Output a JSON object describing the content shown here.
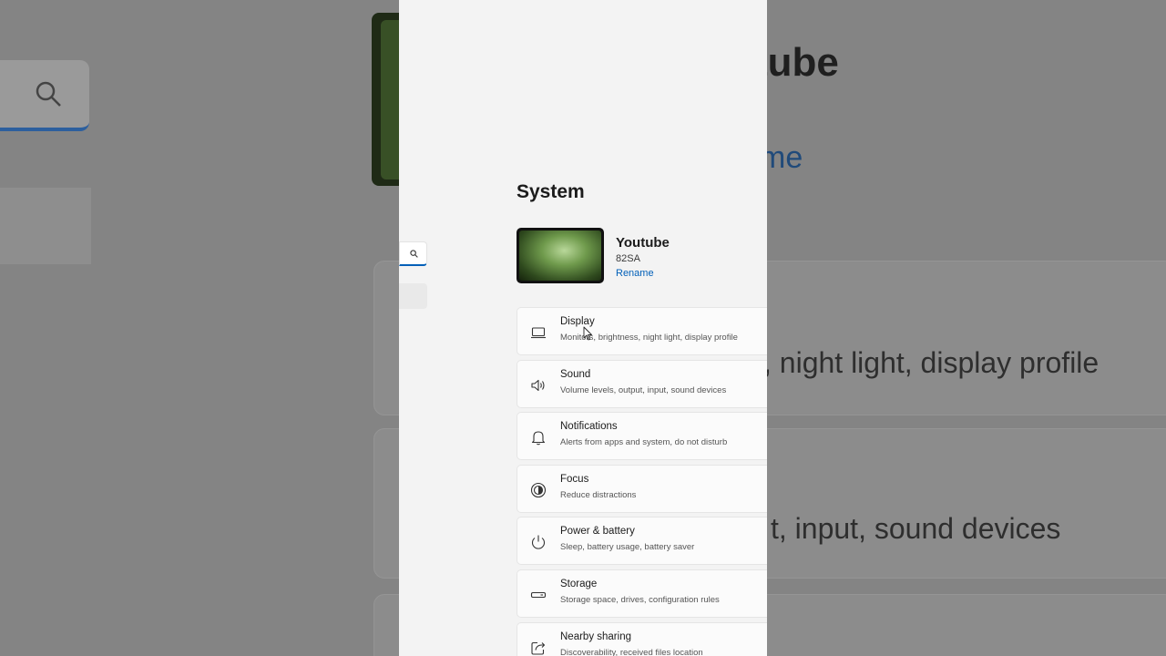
{
  "page": {
    "title": "System"
  },
  "device": {
    "name": "Youtube",
    "model": "82SA",
    "rename_label": "Rename"
  },
  "settings_items": [
    {
      "icon": "laptop-icon",
      "title": "Display",
      "subtitle": "Monitors, brightness, night light, display profile"
    },
    {
      "icon": "speaker-icon",
      "title": "Sound",
      "subtitle": "Volume levels, output, input, sound devices"
    },
    {
      "icon": "bell-icon",
      "title": "Notifications",
      "subtitle": "Alerts from apps and system, do not disturb"
    },
    {
      "icon": "focus-icon",
      "title": "Focus",
      "subtitle": "Reduce distractions"
    },
    {
      "icon": "power-icon",
      "title": "Power & battery",
      "subtitle": "Sleep, battery usage, battery saver"
    },
    {
      "icon": "storage-icon",
      "title": "Storage",
      "subtitle": "Storage space, drives, configuration rules"
    },
    {
      "icon": "share-icon",
      "title": "Nearby sharing",
      "subtitle": "Discoverability, received files location"
    }
  ],
  "background": {
    "title_fragment": "tube",
    "link_fragment": "me",
    "display_fragment": ", night light, display profile",
    "sound_fragment": "t, input, sound devices"
  },
  "colors": {
    "accent": "#005fb8",
    "surface": "#f3f3f3",
    "card": "#fbfbfb"
  }
}
